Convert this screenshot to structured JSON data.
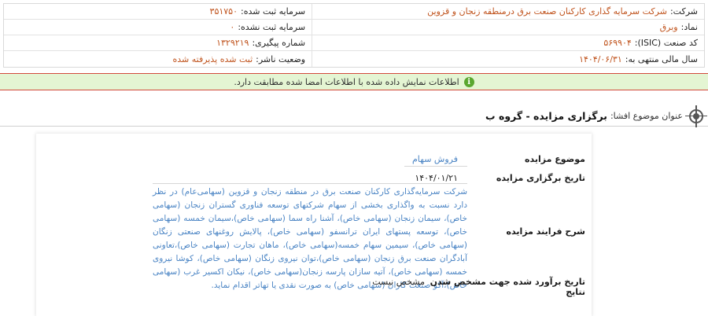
{
  "info": {
    "company_label": "شرکت:",
    "company_value": "شرکت سرمایه گذاری کارکنان صنعت برق درمنطقه زنجان و قزوین",
    "registered_capital_label": "سرمایه ثبت شده:",
    "registered_capital_value": "۳۵۱۷۵۰",
    "symbol_label": "نماد:",
    "symbol_value": "وبرق",
    "unregistered_capital_label": "سرمایه ثبت نشده:",
    "unregistered_capital_value": "۰",
    "isic_label": "کد صنعت (ISIC):",
    "isic_value": "۵۶۹۹۰۴",
    "tracking_label": "شماره پیگیری:",
    "tracking_value": "۱۳۲۹۲۱۹",
    "fiscal_year_label": "سال مالی منتهی به:",
    "fiscal_year_value": "۱۴۰۴/۰۶/۳۱",
    "publisher_status_label": "وضعیت ناشر:",
    "publisher_status_value": "ثبت شده پذیرفته شده"
  },
  "alert": {
    "icon": "info-icon",
    "icon_glyph": "i",
    "text": "اطلاعات نمایش داده شده با اطلاعات امضا شده مطابقت دارد."
  },
  "subject": {
    "label": "عنوان موضوع افشا:",
    "value": "برگزاری مزایده - گروه ب"
  },
  "auction": {
    "topic_label": "موضوع مزایده",
    "topic_value": "فروش سهام",
    "date_label": "تاریخ برگزاری مزایده",
    "date_value": "۱۴۰۴/۰۱/۲۱",
    "process_label": "شرح فرایند مزایده",
    "process_value": "شرکت سرمایه‌گذاری کارکنان صنعت برق در منطقه زنجان و قزوین (سهامی‌عام) در نظر دارد نسبت به واگذاری بخشی از سهام شرکتهای توسعه فناوری گستران زنجان (سهامی خاص)، سیمان زنجان (سهامی خاص)، آشنا راه سما (سهامی خاص)،سیمان خمسه (سهامی خاص)، توسعه پستهای ایران ترانسفو (سهامی خاص)، پالایش روغنهای صنعتی زنگان (سهامی خاص)، سیمین سهام خمسه(سهامی خاص)، ماهان تجارت (سهامی خاص)،تعاونی آبادگران صنعت برق زنجان (سهامی خاص)،توان نیروی زنگان (سهامی خاص)، کوشا نیروی خمسه (سهامی خاص)، آتیه سازان پارسه زنجان(سهامی خاص)، نیکان اکسیر غرب (سهامی خاص)،آکو صنعت کاران (سهامی خاص) به صورت نقدی یا تهاتر اقدام نماید.",
    "estimated_date_label": "تاریخ برآورد شده جهت مشخص شدن نتایج",
    "estimated_date_value": "مشخص نیست"
  }
}
